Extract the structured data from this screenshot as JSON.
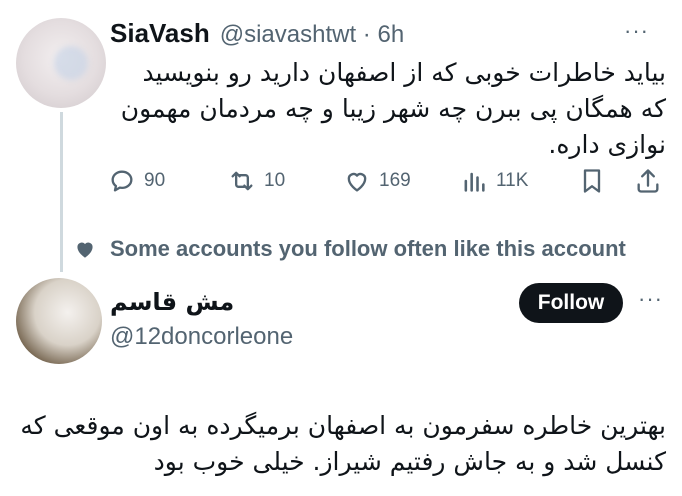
{
  "tweet1": {
    "name": "SiaVash",
    "handle_time": "@siavashtwt · 6h",
    "more": "···",
    "text": "بیاید خاطرات خوبی که از اصفهان دارید رو بنویسید که همگان پی ببرن چه شهر زیبا و چه مردمان مهمون نوازی داره.",
    "actions": {
      "replies": "90",
      "retweets": "10",
      "likes": "169",
      "views": "11K"
    }
  },
  "social_context": {
    "label": "Some accounts you follow often like this account"
  },
  "tweet2": {
    "name": "مش قاسم",
    "handle": "@12doncorleone",
    "follow_label": "Follow",
    "more": "···",
    "text": "بهترین خاطره سفرمون به اصفهان برمیگرده به اون موقعی که کنسل شد و به جاش رفتیم شیراز. خیلی خوب بود"
  },
  "icons": {
    "reply": "reply-icon",
    "retweet": "retweet-icon",
    "like": "heart-icon",
    "views": "views-icon",
    "bookmark": "bookmark-icon",
    "share": "share-icon",
    "social": "heart-icon"
  },
  "colors": {
    "text": "#0f1419",
    "secondary": "#536471",
    "follow_bg": "#0f1419",
    "thread_line": "#cfd9de"
  }
}
